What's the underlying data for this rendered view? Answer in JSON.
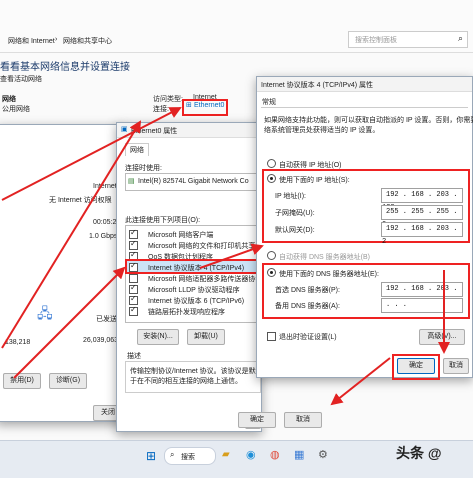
{
  "colors": {
    "highlight": "#e22222",
    "accent": "#0067c0",
    "taskbar": "#eef2f7"
  },
  "bg_window": {
    "breadcrumb": [
      "网络和 Internet",
      "网络和共享中心"
    ],
    "search_placeholder": "搜索控制面板",
    "heading": "看看基本网络信息并设置连接",
    "subheading": "查看活动网络",
    "network_name": "网络",
    "network_type": "公用网络",
    "access_type_label": "访问类型:",
    "access_type_value": "Internet",
    "connection_label": "连接:",
    "connection_value": "Ethernet0"
  },
  "status_panel": {
    "rows": [
      "Internet",
      "无 Internet 访问权限",
      "",
      "",
      "1.0 Gbps"
    ],
    "time": "00:05:29",
    "sent_label": "已发送",
    "bytes_left": "138,218",
    "bytes_right": "26,039,063",
    "btn_disable": "禁用(D)",
    "btn_diagnose": "诊断(G)",
    "btn_close": "关闭"
  },
  "props_dialog": {
    "title": "Ethernet0 属性",
    "tab": "网络",
    "connect_using_label": "连接时使用:",
    "adapter": "Intel(R) 82574L Gigabit Network Co",
    "items_label": "此连接使用下列项目(O):",
    "items": [
      "Microsoft 网络客户端",
      "Microsoft 网络的文件和打印机共享",
      "QoS 数据包计划程序",
      "Internet 协议版本 4 (TCP/IPv4)",
      "Microsoft 网络适配器多路传送器协议",
      "Microsoft LLDP 协议驱动程序",
      "Internet 协议版本 6 (TCP/IPv6)",
      "链路层拓扑发现响应程序"
    ],
    "btn_install": "安装(N)...",
    "btn_uninstall": "卸载(U)",
    "btn_properties": "属性(R)",
    "desc_label": "描述",
    "desc_text_1": "传输控制协议/Internet 协议。该协议是默认的",
    "desc_text_2": "于在不同的相互连接的网络上通信。",
    "btn_ok": "确定",
    "btn_cancel": "取消"
  },
  "ipv4_dialog": {
    "title": "Internet 协议版本 4 (TCP/IPv4) 属性",
    "tab": "常规",
    "intro_1": "如果网络支持此功能，则可以获取自动指派的 IP 设置。否则，你需要从网",
    "intro_2": "络系统管理员处获得适当的 IP 设置。",
    "auto_ip": "自动获得 IP 地址(O)",
    "use_ip": "使用下面的 IP 地址(S):",
    "ip_label": "IP 地址(I):",
    "ip_value": "192 . 168 . 203 . 128",
    "mask_label": "子网掩码(U):",
    "mask_value": "255 . 255 . 255 .  0",
    "gateway_label": "默认网关(D):",
    "gateway_value": "192 . 168 . 203 .  2",
    "auto_dns": "自动获得 DNS 服务器地址(B)",
    "use_dns": "使用下面的 DNS 服务器地址(E):",
    "dns1_label": "首选 DNS 服务器(P):",
    "dns1_value": "192 . 168 . 203 . 133",
    "dns2_label": "备用 DNS 服务器(A):",
    "dns2_value": "  .     .     .",
    "validate": "退出时验证设置(L)",
    "btn_advanced": "高级(V)...",
    "btn_ok": "确定",
    "btn_cancel": "取消"
  },
  "taskbar": {
    "search": "搜索"
  },
  "watermark": "头条 @"
}
